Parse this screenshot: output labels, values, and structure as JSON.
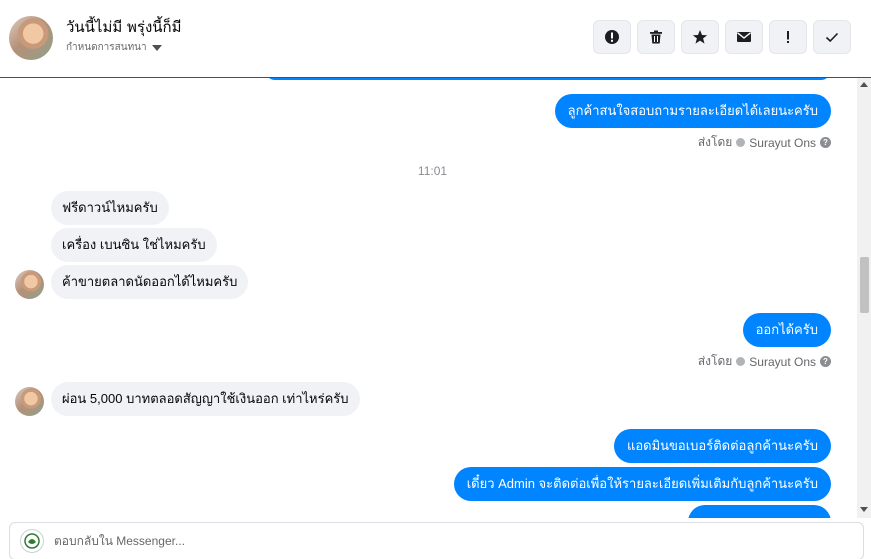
{
  "header": {
    "name": "วันนี้ไม่มี พรุ่งนี้ก็มี",
    "subtitle": "กำหนดการสนทนา",
    "actions": [
      {
        "name": "report-button",
        "icon": "alert-circle-icon"
      },
      {
        "name": "delete-button",
        "icon": "trash-icon"
      },
      {
        "name": "star-button",
        "icon": "star-icon"
      },
      {
        "name": "mark-unread-button",
        "icon": "envelope-icon"
      },
      {
        "name": "important-button",
        "icon": "exclamation-icon"
      },
      {
        "name": "done-button",
        "icon": "check-icon"
      }
    ]
  },
  "thread": {
    "msg_out_1": "ลูกค้าสนใจสอบถามรายละเอียดได้เลยนะครับ",
    "sent_by_label_1": "ส่งโดย",
    "sent_by_name_1": "Surayut Ons",
    "timestamp": "11:01",
    "msg_in_1": "ฟรีดาวน์ไหมครับ",
    "msg_in_2": "เครื่อง เบนซิน ใช่ไหมครับ",
    "msg_in_3": "ค้าขายตลาดนัดออกได้ไหมครับ",
    "msg_out_2": "ออกได้ครับ",
    "sent_by_label_2": "ส่งโดย",
    "sent_by_name_2": "Surayut Ons",
    "msg_in_4": "ผ่อน 5,000 บาทตลอดสัญญาใช้เงินออก เท่าไหร่ครับ",
    "msg_out_3": "แอดมินขอเบอร์ติดต่อลูกค้านะครับ",
    "msg_out_4": "เดี๋ยว Admin จะติดต่อเพื่อให้รายละเอียดเพิ่มเติมกับลูกค้านะครับ"
  },
  "composer": {
    "placeholder": "ตอบกลับใน Messenger..."
  },
  "colors": {
    "outgoing_bubble": "#0084ff",
    "incoming_bubble": "#f0f2f5",
    "secondary_text": "#65676b"
  }
}
